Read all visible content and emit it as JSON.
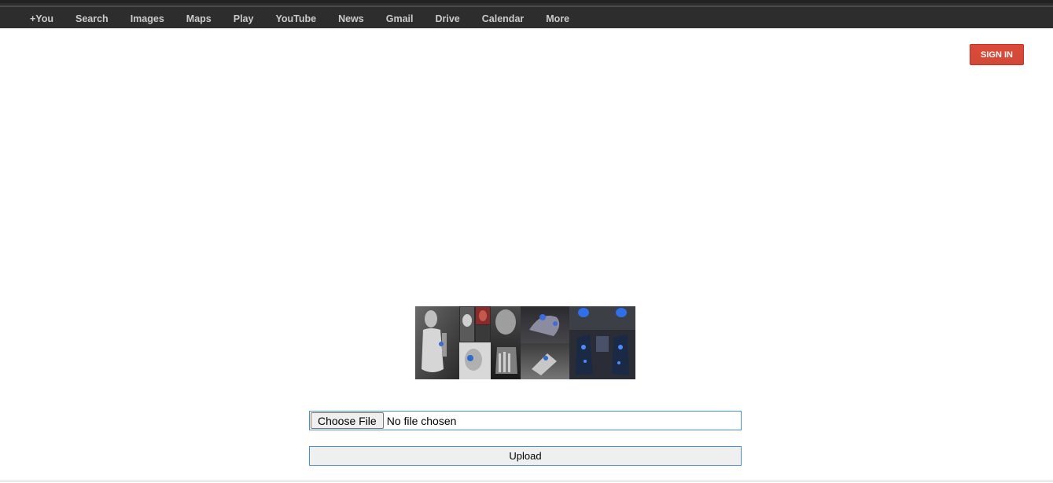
{
  "topbar": {
    "nav_items": [
      "+You",
      "Search",
      "Images",
      "Maps",
      "Play",
      "YouTube",
      "News",
      "Gmail",
      "Drive",
      "Calendar",
      "More"
    ]
  },
  "header": {
    "signin_label": "SIGN IN"
  },
  "upload_form": {
    "choose_file_label": "Choose File",
    "file_status": "No file chosen",
    "upload_label": "Upload"
  },
  "colors": {
    "topbar_bg": "#2d2d2d",
    "nav_text": "#cccccc",
    "signin_bg": "#d14836",
    "input_border": "#4a8fd0"
  },
  "icons": {
    "collage": "robot-collage-image"
  }
}
